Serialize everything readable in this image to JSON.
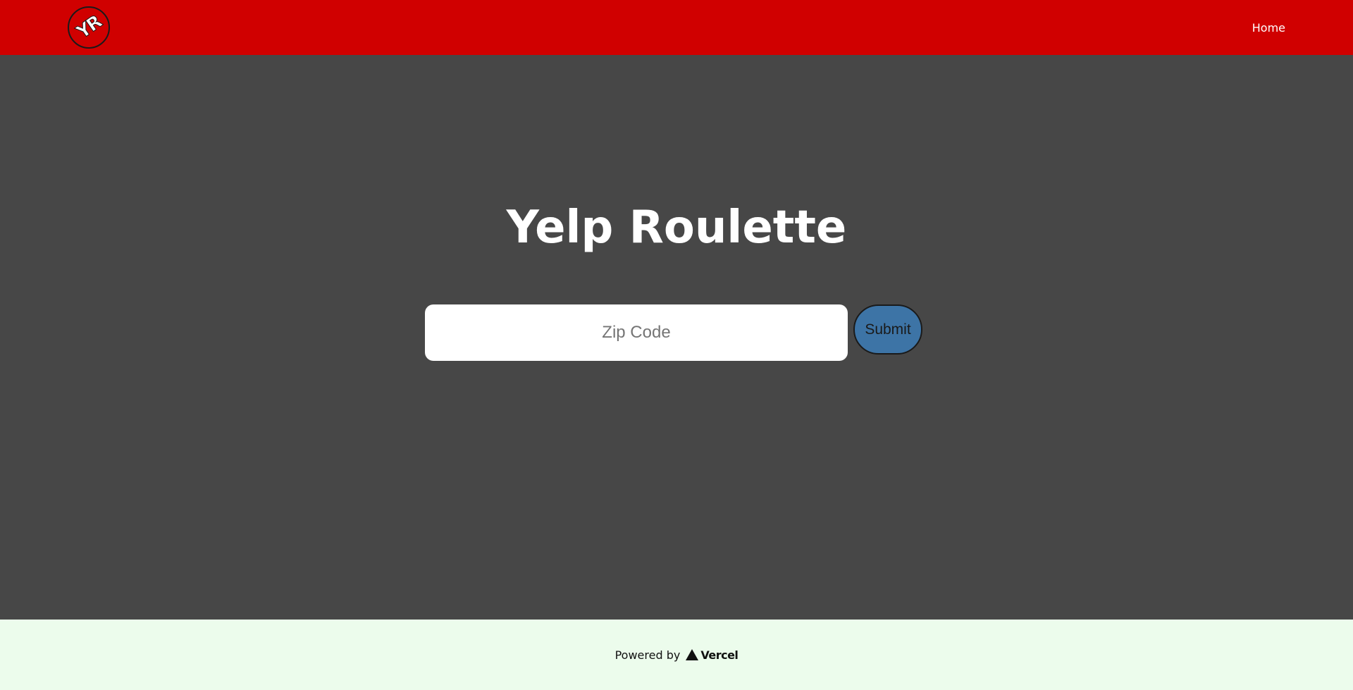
{
  "navbar": {
    "logo_text": "YR",
    "home_label": "Home",
    "background": "#d00000"
  },
  "main": {
    "title": "Yelp Roulette",
    "zip_placeholder": "Zip Code",
    "zip_value": "",
    "submit_label": "Submit",
    "background": "#474747",
    "submit_color": "#3d74a6"
  },
  "footer": {
    "powered_by": "Powered by",
    "vercel_label": "Vercel",
    "vercel_icon": "triangle-icon",
    "background": "#ecfcec"
  }
}
